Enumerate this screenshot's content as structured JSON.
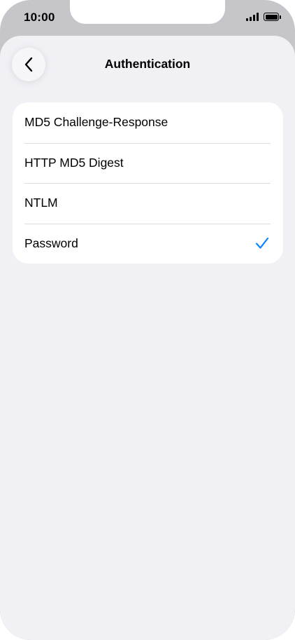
{
  "status_bar": {
    "time": "10:00",
    "icons": [
      "signal-icon",
      "battery-icon"
    ]
  },
  "nav": {
    "back_icon": "chevron-left-icon",
    "title": "Authentication"
  },
  "options": [
    {
      "label": "MD5 Challenge-Response",
      "selected": false
    },
    {
      "label": "HTTP MD5 Digest",
      "selected": false
    },
    {
      "label": "NTLM",
      "selected": false
    },
    {
      "label": "Password",
      "selected": true
    }
  ],
  "colors": {
    "accent": "#0a84ff",
    "background": "#f0f0f5",
    "card": "#ffffff"
  }
}
